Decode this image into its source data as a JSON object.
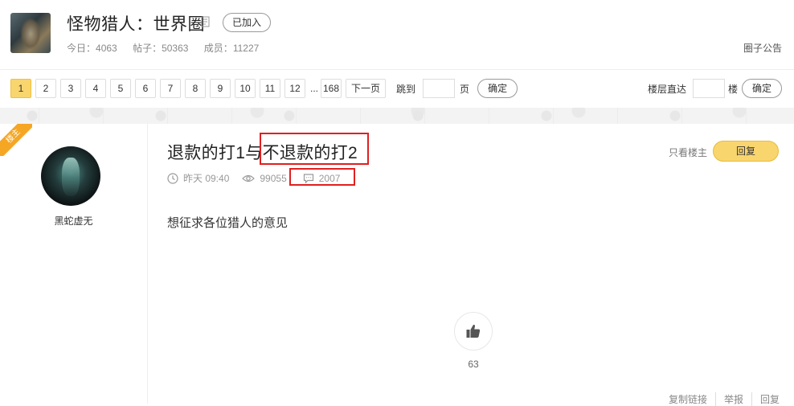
{
  "circle": {
    "title": "怪物猎人：世界圈",
    "joined_label": "已加入",
    "stats": {
      "today_label": "今日：",
      "today_value": "4063",
      "posts_label": "帖子：",
      "posts_value": "50363",
      "members_label": "成员：",
      "members_value": "11227"
    },
    "notice_label": "圈子公告"
  },
  "pager": {
    "pages": [
      "1",
      "2",
      "3",
      "4",
      "5",
      "6",
      "7",
      "8",
      "9",
      "10",
      "11",
      "12"
    ],
    "active_page": "1",
    "ellipsis": "...",
    "last_page": "168",
    "next_label": "下一页",
    "jump_label": "跳到",
    "jump_unit": "页",
    "confirm_label": "确定",
    "floor_label": "楼层直达",
    "floor_unit": "楼",
    "floor_confirm_label": "确定"
  },
  "post": {
    "host_badge": "楼主",
    "username": "黑蛇虚无",
    "title": "退款的打1与不退款的打2",
    "time": "昨天 09:40",
    "views": "99055",
    "comments": "2007",
    "only_host_label": "只看楼主",
    "reply_label": "回复",
    "content": "想征求各位猎人的意见",
    "likes": "63",
    "footer": {
      "copy_link": "复制链接",
      "report": "举报",
      "reply": "回复"
    }
  },
  "colors": {
    "accent": "#f9d56e",
    "highlight_box": "#e02020",
    "host_ribbon": "#f5a623"
  }
}
